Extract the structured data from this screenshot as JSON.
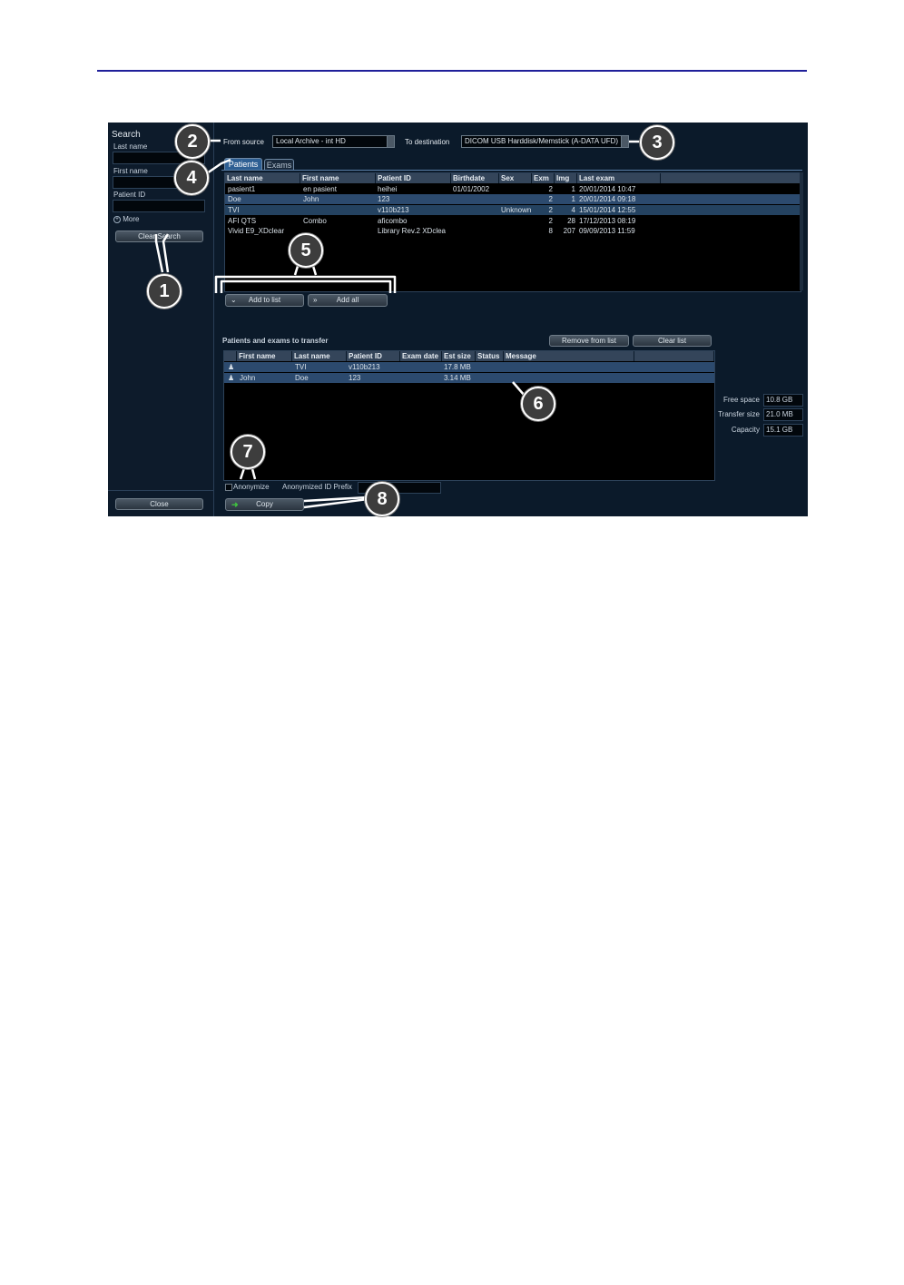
{
  "sidebar": {
    "search_title": "Search",
    "last_name_label": "Last name",
    "first_name_label": "First name",
    "patient_id_label": "Patient ID",
    "more_label": "More",
    "clear_search": "Clear Search",
    "close": "Close"
  },
  "top": {
    "from_source_label": "From source",
    "from_source_value": "Local Archive - int HD",
    "to_destination_label": "To destination",
    "to_destination_value": "DICOM USB Harddisk/Memstick (A-DATA UFD)"
  },
  "tabs": [
    "Patients",
    "Exams"
  ],
  "patients_table": {
    "columns": [
      "Last name",
      "First name",
      "Patient ID",
      "Birthdate",
      "Sex",
      "Exm",
      "Img",
      "Last exam"
    ],
    "rows": [
      [
        "pasient1",
        "en pasient",
        "heihei",
        "01/01/2002",
        "",
        "2",
        "1",
        "20/01/2014 10:47"
      ],
      [
        "Doe",
        "John",
        "123",
        "",
        "",
        "2",
        "1",
        "20/01/2014 09:18"
      ],
      [
        "TVI",
        "",
        "v110b213",
        "",
        "Unknown",
        "2",
        "4",
        "15/01/2014 12:55"
      ],
      [
        "AFI QTS",
        "Combo",
        "aficombo",
        "",
        "",
        "2",
        "28",
        "17/12/2013 08:19"
      ],
      [
        "Vivid E9_XDclear",
        "",
        "Library Rev.2 XDclea",
        "",
        "",
        "8",
        "207",
        "09/09/2013 11:59"
      ]
    ]
  },
  "add_buttons": {
    "add_to_list": "Add to list",
    "add_all": "Add all"
  },
  "transfer": {
    "title": "Patients and exams to transfer",
    "remove_from_list": "Remove from list",
    "clear_list": "Clear list",
    "columns": [
      "First name",
      "Last name",
      "Patient ID",
      "Exam date",
      "Est size",
      "Status",
      "Message"
    ],
    "rows": [
      [
        "",
        "TVI",
        "v110b213",
        "",
        "17.8 MB",
        "",
        ""
      ],
      [
        "John",
        "Doe",
        "123",
        "",
        "3.14 MB",
        "",
        ""
      ]
    ]
  },
  "storage": {
    "free_space_label": "Free space",
    "free_space_value": "10.8 GB",
    "transfer_size_label": "Transfer size",
    "transfer_size_value": "21.0 MB",
    "capacity_label": "Capacity",
    "capacity_value": "15.1 GB"
  },
  "bottom": {
    "anonymize_label": "Anonymize",
    "anonymized_prefix_label": "Anonymized ID Prefix",
    "copy": "Copy"
  },
  "callouts": [
    "1",
    "2",
    "3",
    "4",
    "5",
    "6",
    "7",
    "8"
  ],
  "colors": {
    "rule": "#1f1f9a",
    "background": "#0b1a2a",
    "selection": "#2c4a6e",
    "copy_arrow": "#3fc23f"
  }
}
